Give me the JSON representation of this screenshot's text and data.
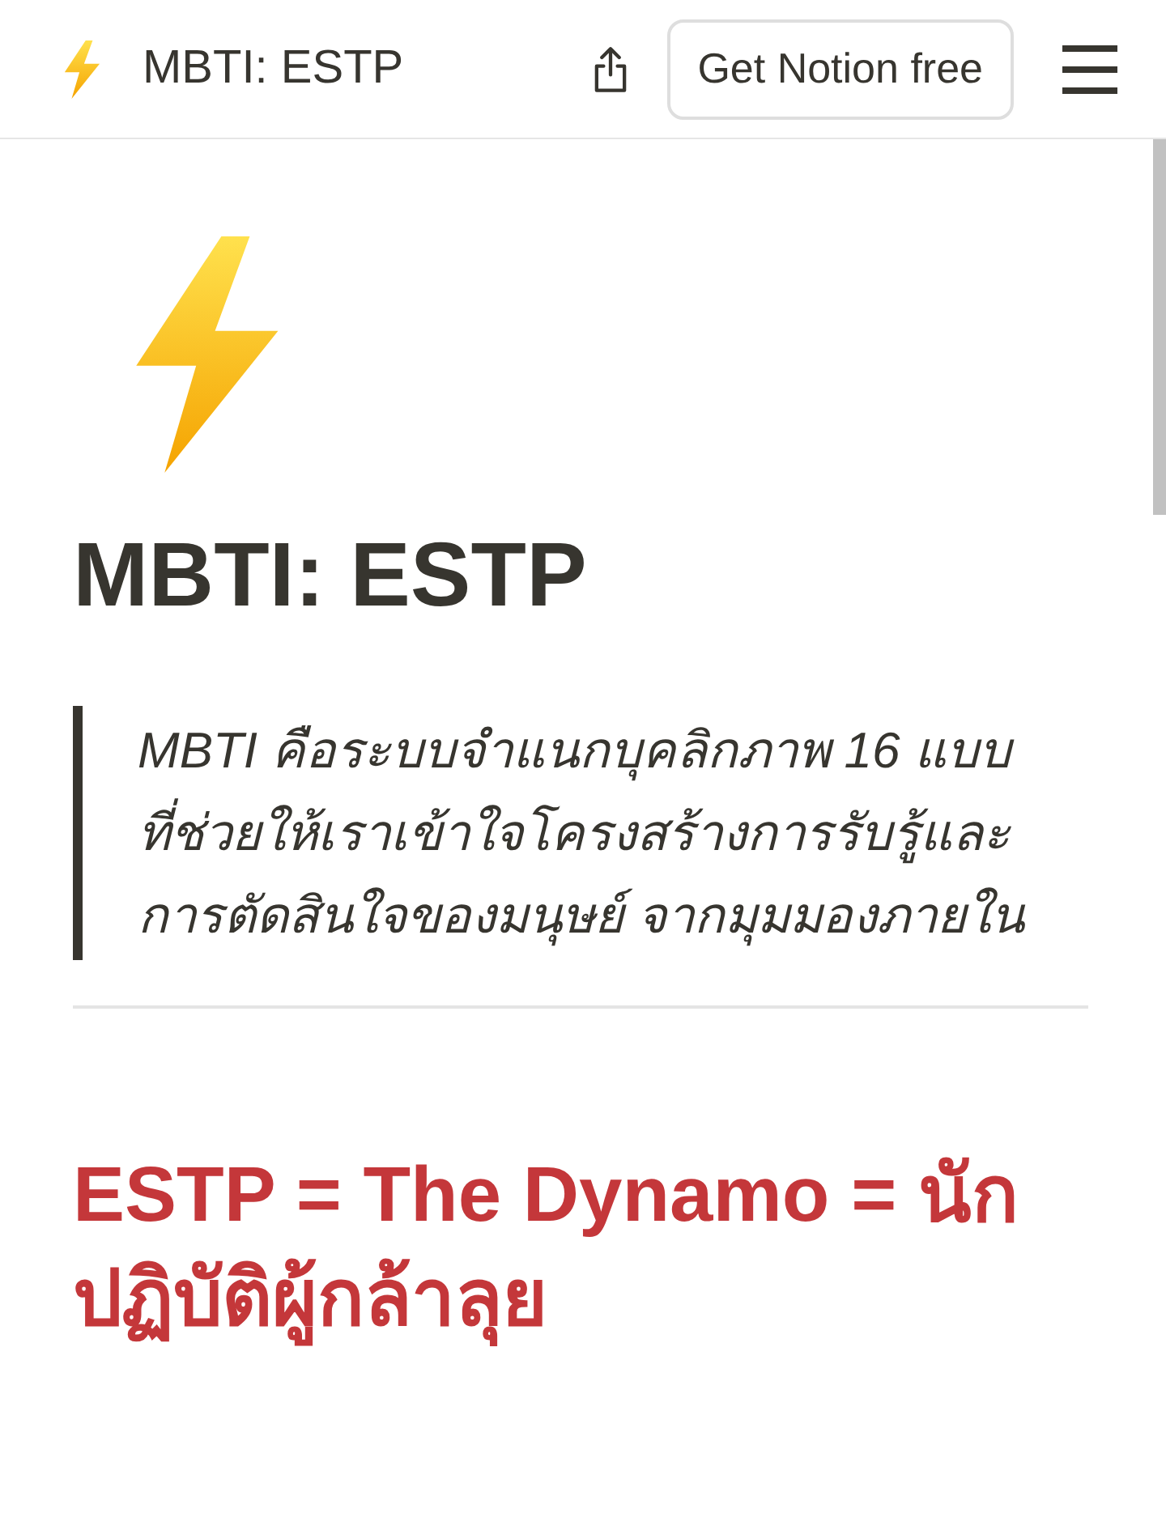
{
  "topbar": {
    "title": "MBTI: ESTP",
    "cta": "Get Notion free"
  },
  "page": {
    "title": "MBTI: ESTP",
    "quote": "MBTI คือระบบจำแนกบุคลิกภาพ 16 แบบ ที่ช่วยให้เราเข้าใจโครงสร้างการรับรู้และการตัดสินใจของมนุษย์ จากมุมมองภายใน",
    "heading": "ESTP = The Dynamo = นักปฏิบัติผู้กล้าลุย"
  }
}
